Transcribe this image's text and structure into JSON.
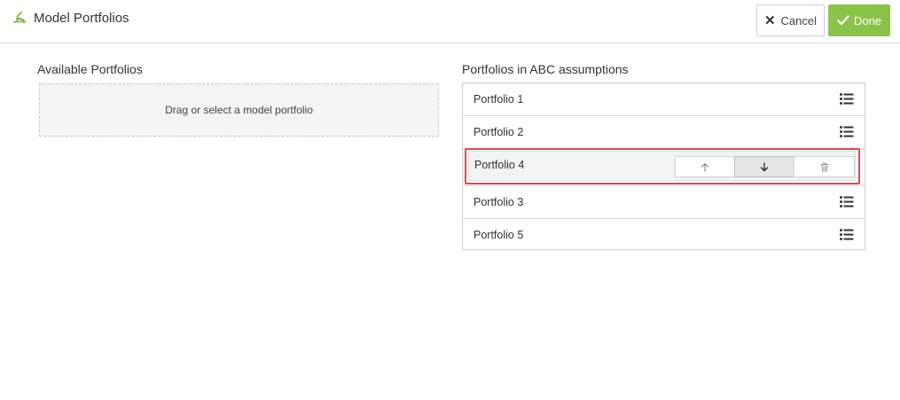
{
  "header": {
    "title": "Model Portfolios",
    "logo_icon": "leaf-logo-icon",
    "accent": "#8bc34a",
    "cancel_label": "Cancel",
    "done_label": "Done"
  },
  "available": {
    "title": "Available Portfolios",
    "dropzone_text": "Drag or select a model portfolio"
  },
  "assumptions": {
    "title": "Portfolios in ABC assumptions",
    "items": [
      {
        "label": "Portfolio 1"
      },
      {
        "label": "Portfolio 2"
      },
      {
        "label": "Portfolio 4"
      },
      {
        "label": "Portfolio 3"
      },
      {
        "label": "Portfolio 5"
      }
    ],
    "selected_index": 2,
    "highlight_color": "#e2474d",
    "row_icon": "list-menu-icon",
    "action_icons": [
      "arrow-up-icon",
      "arrow-down-icon",
      "trash-icon"
    ]
  }
}
